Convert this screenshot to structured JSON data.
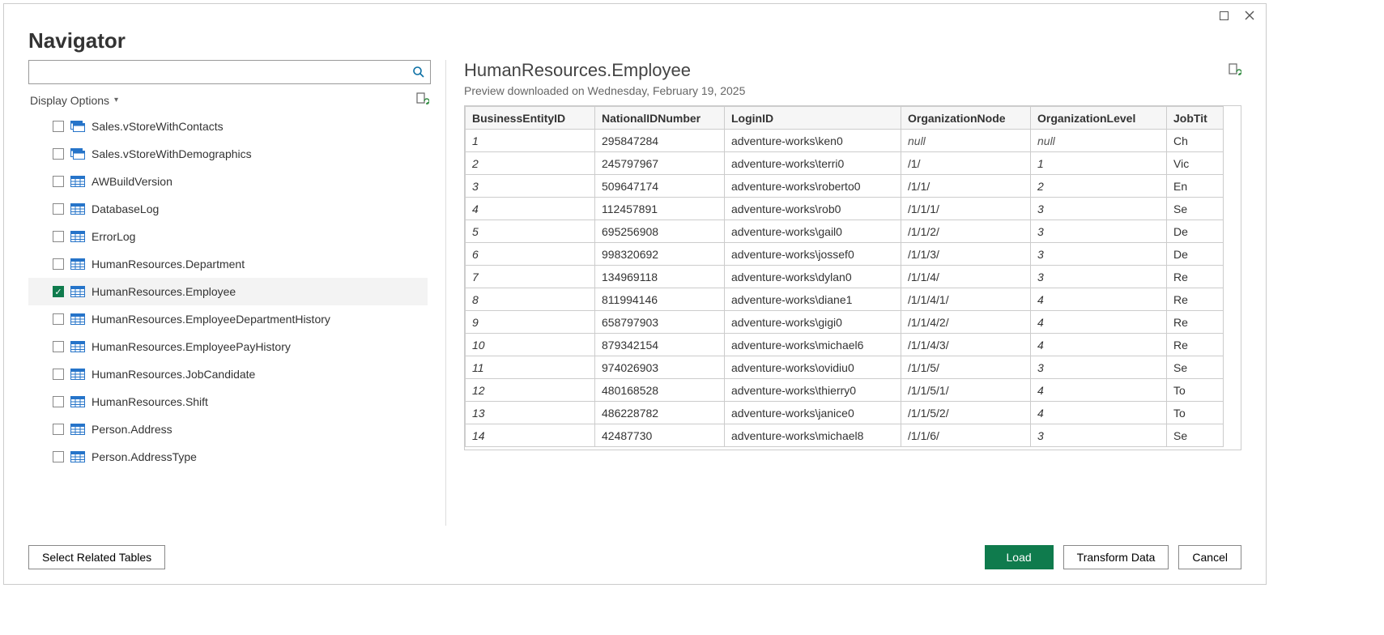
{
  "window": {
    "title": "Navigator"
  },
  "left": {
    "search_placeholder": "",
    "display_options_label": "Display Options",
    "items": [
      {
        "label": "Sales.vStoreWithContacts",
        "type": "view",
        "checked": false,
        "selected": false
      },
      {
        "label": "Sales.vStoreWithDemographics",
        "type": "view",
        "checked": false,
        "selected": false
      },
      {
        "label": "AWBuildVersion",
        "type": "table",
        "checked": false,
        "selected": false
      },
      {
        "label": "DatabaseLog",
        "type": "table",
        "checked": false,
        "selected": false
      },
      {
        "label": "ErrorLog",
        "type": "table",
        "checked": false,
        "selected": false
      },
      {
        "label": "HumanResources.Department",
        "type": "table",
        "checked": false,
        "selected": false
      },
      {
        "label": "HumanResources.Employee",
        "type": "table",
        "checked": true,
        "selected": true
      },
      {
        "label": "HumanResources.EmployeeDepartmentHistory",
        "type": "table",
        "checked": false,
        "selected": false
      },
      {
        "label": "HumanResources.EmployeePayHistory",
        "type": "table",
        "checked": false,
        "selected": false
      },
      {
        "label": "HumanResources.JobCandidate",
        "type": "table",
        "checked": false,
        "selected": false
      },
      {
        "label": "HumanResources.Shift",
        "type": "table",
        "checked": false,
        "selected": false
      },
      {
        "label": "Person.Address",
        "type": "table",
        "checked": false,
        "selected": false
      },
      {
        "label": "Person.AddressType",
        "type": "table",
        "checked": false,
        "selected": false
      }
    ]
  },
  "preview": {
    "title": "HumanResources.Employee",
    "subtitle": "Preview downloaded on Wednesday, February 19, 2025",
    "columns": [
      "BusinessEntityID",
      "NationalIDNumber",
      "LoginID",
      "OrganizationNode",
      "OrganizationLevel",
      "JobTit"
    ],
    "rows": [
      {
        "id": "1",
        "nid": "295847284",
        "login": "adventure-works\\ken0",
        "org": "null",
        "lvl": "null",
        "jt": "Ch"
      },
      {
        "id": "2",
        "nid": "245797967",
        "login": "adventure-works\\terri0",
        "org": "/1/",
        "lvl": "1",
        "jt": "Vic"
      },
      {
        "id": "3",
        "nid": "509647174",
        "login": "adventure-works\\roberto0",
        "org": "/1/1/",
        "lvl": "2",
        "jt": "En"
      },
      {
        "id": "4",
        "nid": "112457891",
        "login": "adventure-works\\rob0",
        "org": "/1/1/1/",
        "lvl": "3",
        "jt": "Se"
      },
      {
        "id": "5",
        "nid": "695256908",
        "login": "adventure-works\\gail0",
        "org": "/1/1/2/",
        "lvl": "3",
        "jt": "De"
      },
      {
        "id": "6",
        "nid": "998320692",
        "login": "adventure-works\\jossef0",
        "org": "/1/1/3/",
        "lvl": "3",
        "jt": "De"
      },
      {
        "id": "7",
        "nid": "134969118",
        "login": "adventure-works\\dylan0",
        "org": "/1/1/4/",
        "lvl": "3",
        "jt": "Re"
      },
      {
        "id": "8",
        "nid": "811994146",
        "login": "adventure-works\\diane1",
        "org": "/1/1/4/1/",
        "lvl": "4",
        "jt": "Re"
      },
      {
        "id": "9",
        "nid": "658797903",
        "login": "adventure-works\\gigi0",
        "org": "/1/1/4/2/",
        "lvl": "4",
        "jt": "Re"
      },
      {
        "id": "10",
        "nid": "879342154",
        "login": "adventure-works\\michael6",
        "org": "/1/1/4/3/",
        "lvl": "4",
        "jt": "Re"
      },
      {
        "id": "11",
        "nid": "974026903",
        "login": "adventure-works\\ovidiu0",
        "org": "/1/1/5/",
        "lvl": "3",
        "jt": "Se"
      },
      {
        "id": "12",
        "nid": "480168528",
        "login": "adventure-works\\thierry0",
        "org": "/1/1/5/1/",
        "lvl": "4",
        "jt": "To"
      },
      {
        "id": "13",
        "nid": "486228782",
        "login": "adventure-works\\janice0",
        "org": "/1/1/5/2/",
        "lvl": "4",
        "jt": "To"
      },
      {
        "id": "14",
        "nid": "42487730",
        "login": "adventure-works\\michael8",
        "org": "/1/1/6/",
        "lvl": "3",
        "jt": "Se"
      }
    ]
  },
  "footer": {
    "select_related": "Select Related Tables",
    "load": "Load",
    "transform": "Transform Data",
    "cancel": "Cancel"
  }
}
